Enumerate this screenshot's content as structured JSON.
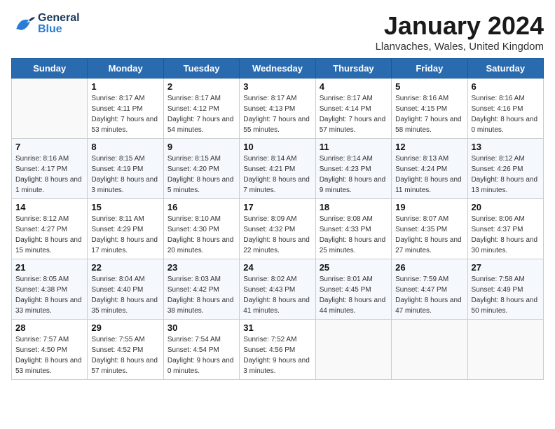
{
  "header": {
    "logo_general": "General",
    "logo_blue": "Blue",
    "month_title": "January 2024",
    "subtitle": "Llanvaches, Wales, United Kingdom"
  },
  "weekdays": [
    "Sunday",
    "Monday",
    "Tuesday",
    "Wednesday",
    "Thursday",
    "Friday",
    "Saturday"
  ],
  "weeks": [
    [
      {
        "day": "",
        "sunrise": "",
        "sunset": "",
        "daylight": ""
      },
      {
        "day": "1",
        "sunrise": "Sunrise: 8:17 AM",
        "sunset": "Sunset: 4:11 PM",
        "daylight": "Daylight: 7 hours and 53 minutes."
      },
      {
        "day": "2",
        "sunrise": "Sunrise: 8:17 AM",
        "sunset": "Sunset: 4:12 PM",
        "daylight": "Daylight: 7 hours and 54 minutes."
      },
      {
        "day": "3",
        "sunrise": "Sunrise: 8:17 AM",
        "sunset": "Sunset: 4:13 PM",
        "daylight": "Daylight: 7 hours and 55 minutes."
      },
      {
        "day": "4",
        "sunrise": "Sunrise: 8:17 AM",
        "sunset": "Sunset: 4:14 PM",
        "daylight": "Daylight: 7 hours and 57 minutes."
      },
      {
        "day": "5",
        "sunrise": "Sunrise: 8:16 AM",
        "sunset": "Sunset: 4:15 PM",
        "daylight": "Daylight: 7 hours and 58 minutes."
      },
      {
        "day": "6",
        "sunrise": "Sunrise: 8:16 AM",
        "sunset": "Sunset: 4:16 PM",
        "daylight": "Daylight: 8 hours and 0 minutes."
      }
    ],
    [
      {
        "day": "7",
        "sunrise": "Sunrise: 8:16 AM",
        "sunset": "Sunset: 4:17 PM",
        "daylight": "Daylight: 8 hours and 1 minute."
      },
      {
        "day": "8",
        "sunrise": "Sunrise: 8:15 AM",
        "sunset": "Sunset: 4:19 PM",
        "daylight": "Daylight: 8 hours and 3 minutes."
      },
      {
        "day": "9",
        "sunrise": "Sunrise: 8:15 AM",
        "sunset": "Sunset: 4:20 PM",
        "daylight": "Daylight: 8 hours and 5 minutes."
      },
      {
        "day": "10",
        "sunrise": "Sunrise: 8:14 AM",
        "sunset": "Sunset: 4:21 PM",
        "daylight": "Daylight: 8 hours and 7 minutes."
      },
      {
        "day": "11",
        "sunrise": "Sunrise: 8:14 AM",
        "sunset": "Sunset: 4:23 PM",
        "daylight": "Daylight: 8 hours and 9 minutes."
      },
      {
        "day": "12",
        "sunrise": "Sunrise: 8:13 AM",
        "sunset": "Sunset: 4:24 PM",
        "daylight": "Daylight: 8 hours and 11 minutes."
      },
      {
        "day": "13",
        "sunrise": "Sunrise: 8:12 AM",
        "sunset": "Sunset: 4:26 PM",
        "daylight": "Daylight: 8 hours and 13 minutes."
      }
    ],
    [
      {
        "day": "14",
        "sunrise": "Sunrise: 8:12 AM",
        "sunset": "Sunset: 4:27 PM",
        "daylight": "Daylight: 8 hours and 15 minutes."
      },
      {
        "day": "15",
        "sunrise": "Sunrise: 8:11 AM",
        "sunset": "Sunset: 4:29 PM",
        "daylight": "Daylight: 8 hours and 17 minutes."
      },
      {
        "day": "16",
        "sunrise": "Sunrise: 8:10 AM",
        "sunset": "Sunset: 4:30 PM",
        "daylight": "Daylight: 8 hours and 20 minutes."
      },
      {
        "day": "17",
        "sunrise": "Sunrise: 8:09 AM",
        "sunset": "Sunset: 4:32 PM",
        "daylight": "Daylight: 8 hours and 22 minutes."
      },
      {
        "day": "18",
        "sunrise": "Sunrise: 8:08 AM",
        "sunset": "Sunset: 4:33 PM",
        "daylight": "Daylight: 8 hours and 25 minutes."
      },
      {
        "day": "19",
        "sunrise": "Sunrise: 8:07 AM",
        "sunset": "Sunset: 4:35 PM",
        "daylight": "Daylight: 8 hours and 27 minutes."
      },
      {
        "day": "20",
        "sunrise": "Sunrise: 8:06 AM",
        "sunset": "Sunset: 4:37 PM",
        "daylight": "Daylight: 8 hours and 30 minutes."
      }
    ],
    [
      {
        "day": "21",
        "sunrise": "Sunrise: 8:05 AM",
        "sunset": "Sunset: 4:38 PM",
        "daylight": "Daylight: 8 hours and 33 minutes."
      },
      {
        "day": "22",
        "sunrise": "Sunrise: 8:04 AM",
        "sunset": "Sunset: 4:40 PM",
        "daylight": "Daylight: 8 hours and 35 minutes."
      },
      {
        "day": "23",
        "sunrise": "Sunrise: 8:03 AM",
        "sunset": "Sunset: 4:42 PM",
        "daylight": "Daylight: 8 hours and 38 minutes."
      },
      {
        "day": "24",
        "sunrise": "Sunrise: 8:02 AM",
        "sunset": "Sunset: 4:43 PM",
        "daylight": "Daylight: 8 hours and 41 minutes."
      },
      {
        "day": "25",
        "sunrise": "Sunrise: 8:01 AM",
        "sunset": "Sunset: 4:45 PM",
        "daylight": "Daylight: 8 hours and 44 minutes."
      },
      {
        "day": "26",
        "sunrise": "Sunrise: 7:59 AM",
        "sunset": "Sunset: 4:47 PM",
        "daylight": "Daylight: 8 hours and 47 minutes."
      },
      {
        "day": "27",
        "sunrise": "Sunrise: 7:58 AM",
        "sunset": "Sunset: 4:49 PM",
        "daylight": "Daylight: 8 hours and 50 minutes."
      }
    ],
    [
      {
        "day": "28",
        "sunrise": "Sunrise: 7:57 AM",
        "sunset": "Sunset: 4:50 PM",
        "daylight": "Daylight: 8 hours and 53 minutes."
      },
      {
        "day": "29",
        "sunrise": "Sunrise: 7:55 AM",
        "sunset": "Sunset: 4:52 PM",
        "daylight": "Daylight: 8 hours and 57 minutes."
      },
      {
        "day": "30",
        "sunrise": "Sunrise: 7:54 AM",
        "sunset": "Sunset: 4:54 PM",
        "daylight": "Daylight: 9 hours and 0 minutes."
      },
      {
        "day": "31",
        "sunrise": "Sunrise: 7:52 AM",
        "sunset": "Sunset: 4:56 PM",
        "daylight": "Daylight: 9 hours and 3 minutes."
      },
      {
        "day": "",
        "sunrise": "",
        "sunset": "",
        "daylight": ""
      },
      {
        "day": "",
        "sunrise": "",
        "sunset": "",
        "daylight": ""
      },
      {
        "day": "",
        "sunrise": "",
        "sunset": "",
        "daylight": ""
      }
    ]
  ]
}
